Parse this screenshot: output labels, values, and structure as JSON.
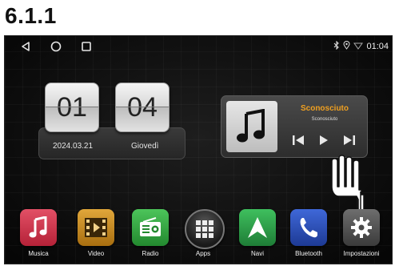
{
  "section_title": "6.1.1",
  "status": {
    "time": "01:04",
    "icons": [
      "bluetooth-icon",
      "location-icon",
      "wifi-icon"
    ]
  },
  "nav": {
    "icons": [
      "back-icon",
      "home-icon",
      "recents-icon"
    ]
  },
  "clock": {
    "hour": "01",
    "minute": "04",
    "date": "2024.03.21",
    "day": "Giovedì"
  },
  "music": {
    "title": "Sconosciuto",
    "artist": "Sconosciuto",
    "title_color": "#f0a020"
  },
  "apps": [
    {
      "label": "Musica",
      "icon": "music-icon",
      "color": "#d9364f"
    },
    {
      "label": "Video",
      "icon": "video-icon",
      "color": "#c98a1a"
    },
    {
      "label": "Radio",
      "icon": "radio-icon",
      "color": "#3aa845"
    },
    {
      "label": "Apps",
      "icon": "apps-grid-icon",
      "color": "#2a2a2a"
    },
    {
      "label": "Navi",
      "icon": "navigation-icon",
      "color": "#2f9e4b"
    },
    {
      "label": "Bluetooth",
      "icon": "phone-icon",
      "color": "#2c4fb8"
    },
    {
      "label": "Impostazioni",
      "icon": "settings-icon",
      "color": "#555555"
    }
  ]
}
